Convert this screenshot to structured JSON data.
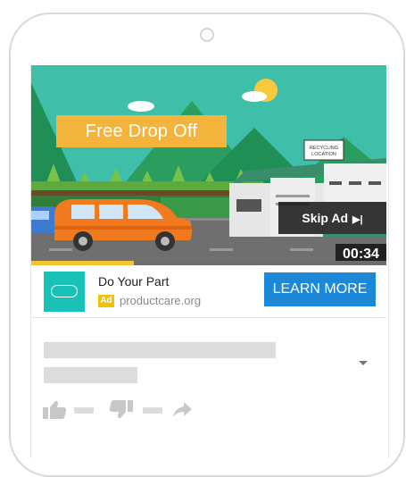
{
  "video": {
    "promo_text": "Free Drop Off",
    "sign_text_1": "RECYCLING",
    "sign_text_2": "LOCATION",
    "skip_label": "Skip Ad",
    "skip_arrow": "▶|",
    "timer": "00:34",
    "progress_fraction": 0.29
  },
  "ad": {
    "title": "Do Your Part",
    "badge": "Ad",
    "url": "productcare.org",
    "cta_label": "LEARN MORE"
  },
  "colors": {
    "sky": "#3fbfa9",
    "promo_bg": "#f4b33b",
    "cta_bg": "#1e88d8",
    "logo_bg": "#19c2b6",
    "badge_bg": "#f2c200",
    "placeholder": "#dcdcdc"
  },
  "icons": [
    "thumbs-up-icon",
    "thumbs-down-icon",
    "share-icon",
    "dropdown-caret-icon"
  ]
}
